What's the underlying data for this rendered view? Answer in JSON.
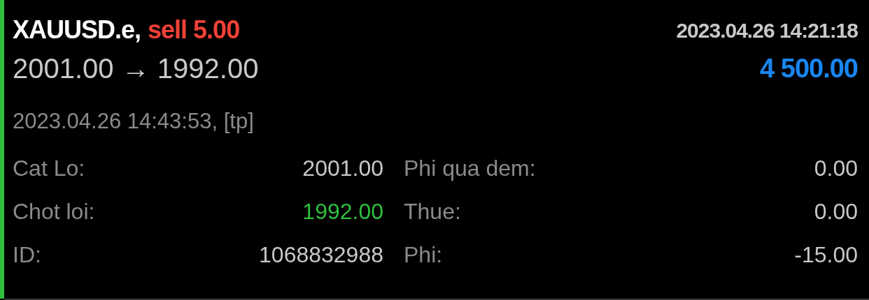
{
  "symbol": "XAUUSD.e,",
  "order": {
    "text": "sell 5.00",
    "kind": "sell"
  },
  "open_time": "2023.04.26 14:21:18",
  "prices": "2001.00 → 1992.00",
  "profit": "4 500.00",
  "close_info": "2023.04.26 14:43:53, [tp]",
  "details": [
    [
      {
        "label": "Cat Lo:",
        "value": "2001.00",
        "color": "#c8c8c8"
      },
      {
        "label": "Phi qua dem:",
        "value": "0.00",
        "color": "#c8c8c8"
      }
    ],
    [
      {
        "label": "Chot loi:",
        "value": "1992.00",
        "color": "#2fbf3f"
      },
      {
        "label": "Thue:",
        "value": "0.00",
        "color": "#c8c8c8"
      }
    ],
    [
      {
        "label": "ID:",
        "value": "1068832988",
        "color": "#c8c8c8"
      },
      {
        "label": "Phi:",
        "value": "-15.00",
        "color": "#c8c8c8"
      }
    ]
  ]
}
